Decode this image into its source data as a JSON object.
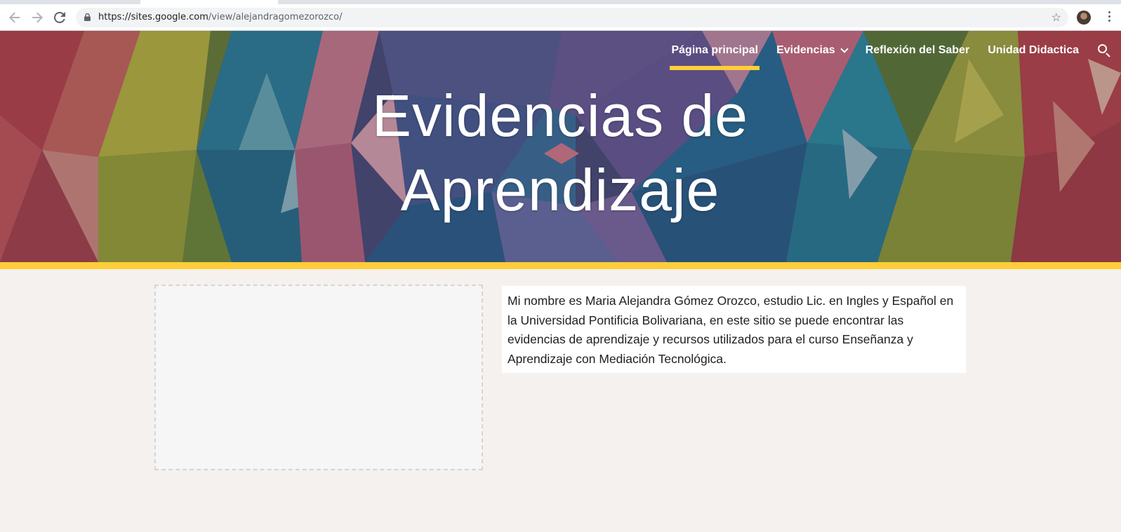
{
  "browser": {
    "url_host": "https://sites.google.com",
    "url_path": "/view/alejandragomezorozco/",
    "back_icon": "arrow-left-icon",
    "forward_icon": "arrow-right-icon",
    "reload_icon": "reload-icon",
    "bookmark_icon": "star-icon"
  },
  "site_nav": {
    "items": [
      {
        "label": "Página principal",
        "active": true
      },
      {
        "label": "Evidencias",
        "has_dropdown": true
      },
      {
        "label": "Reflexión del Saber"
      },
      {
        "label": "Unidad Didactica"
      }
    ],
    "search_icon": "search-icon"
  },
  "hero": {
    "title_line1": "Evidencias de",
    "title_line2": "Aprendizaje",
    "accent_color": "#ffcd3a"
  },
  "content": {
    "intro_text": "Mi nombre es Maria Alejandra Gómez Orozco, estudio Lic. en Ingles y Español en la Universidad Pontificia Bolivariana, en este sitio se puede encontrar las evidencias de aprendizaje y recursos utilizados para el curso Enseñanza y Aprendizaje con Mediación Tecnológica."
  }
}
